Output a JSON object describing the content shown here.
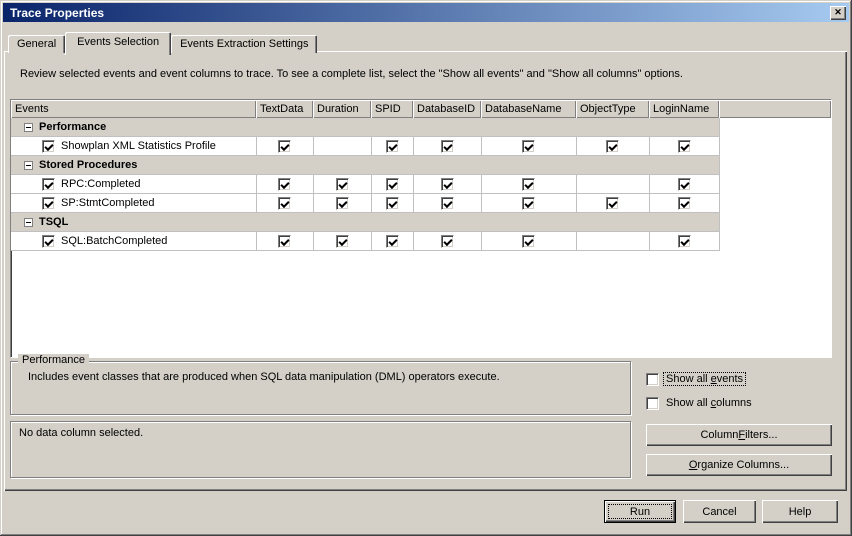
{
  "window": {
    "title": "Trace Properties",
    "icons": {
      "close": "✕"
    }
  },
  "tabs": [
    {
      "label": "General"
    },
    {
      "label": "Events Selection"
    },
    {
      "label": "Events Extraction Settings"
    }
  ],
  "instruction": "Review selected events and event columns to trace. To see a complete list, select the \"Show all events\" and \"Show all columns\" options.",
  "grid": {
    "columns": [
      "Events",
      "TextData",
      "Duration",
      "SPID",
      "DatabaseID",
      "DatabaseName",
      "ObjectType",
      "LoginName"
    ],
    "rows": [
      {
        "type": "category",
        "label": "Performance",
        "expanded": true
      },
      {
        "type": "event",
        "label": "Showplan XML Statistics Profile",
        "checked": true,
        "cells": [
          true,
          null,
          true,
          true,
          true,
          true,
          true
        ]
      },
      {
        "type": "category",
        "label": "Stored Procedures",
        "expanded": true
      },
      {
        "type": "event",
        "label": "RPC:Completed",
        "checked": true,
        "cells": [
          true,
          true,
          true,
          true,
          true,
          null,
          true
        ]
      },
      {
        "type": "event",
        "label": "SP:StmtCompleted",
        "checked": true,
        "cells": [
          true,
          true,
          true,
          true,
          true,
          true,
          true
        ]
      },
      {
        "type": "category",
        "label": "TSQL",
        "expanded": true
      },
      {
        "type": "event",
        "label": "SQL:BatchCompleted",
        "checked": true,
        "cells": [
          true,
          true,
          true,
          true,
          true,
          null,
          true
        ]
      }
    ]
  },
  "description_box": {
    "title": "Performance",
    "text": "Includes event classes that are produced when SQL data manipulation (DML) operators execute."
  },
  "column_box": {
    "text": "No data column selected."
  },
  "options": {
    "show_all_events": {
      "label": "Show all events",
      "checked": false,
      "mnemonic_index": 9
    },
    "show_all_columns": {
      "label": "Show all columns",
      "checked": false,
      "mnemonic_index": 9
    }
  },
  "actions": {
    "column_filters": {
      "label": "Column Filters...",
      "mnemonic_index": 7
    },
    "organize_columns": {
      "label": "Organize Columns...",
      "mnemonic_index": 0
    }
  },
  "footer_buttons": {
    "run": "Run",
    "cancel": "Cancel",
    "help": "Help"
  },
  "colors": {
    "dialog_bg": "#d4d0c8",
    "titlebar_left": "#0a246a",
    "titlebar_right": "#a6caf0",
    "grid_line": "#c0c0c0"
  }
}
